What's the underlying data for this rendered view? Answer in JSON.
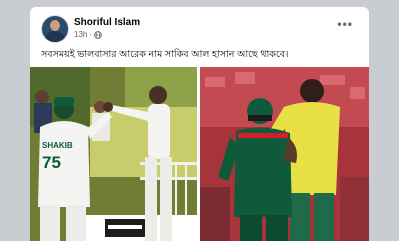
{
  "post": {
    "author": "Shoriful Islam",
    "time": "13h",
    "separator": "·",
    "privacy_icon": "globe-icon",
    "more_icon": "more-options-icon",
    "more_symbol": "•••",
    "text": "সবসময়ই ভালবাসার আরেক নাম সাকিব আল হাসান আছে থাকবে।"
  },
  "photo_left": {
    "jersey_name": "SHAKIB",
    "jersey_number": "75"
  },
  "colors": {
    "bangladesh_green": "#0f5a3a",
    "bangladesh_red": "#d21f2b",
    "whites": "#f4f4f2",
    "bib_yellow": "#e8e045"
  }
}
